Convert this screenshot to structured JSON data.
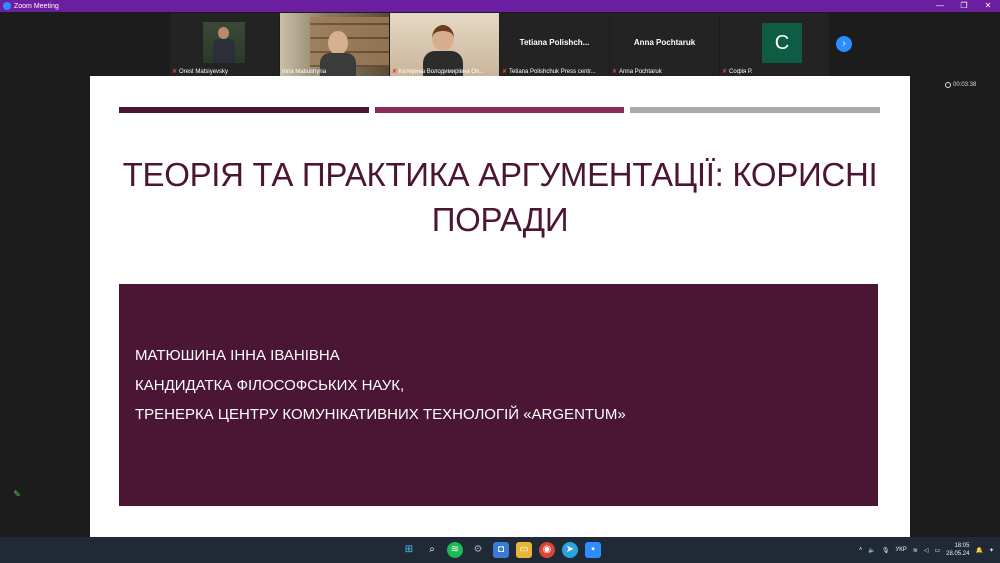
{
  "window": {
    "title": "Zoom Meeting",
    "minimize": "—",
    "maximize": "❐",
    "close": "✕"
  },
  "participants": [
    {
      "name": "Orest Matsiyevsky",
      "muted": true
    },
    {
      "name": "Inna Matiushyna",
      "muted": false
    },
    {
      "name": "Катерина Володимирівна Оп...",
      "muted": true
    },
    {
      "name": "Tetiana Polishchuk Press centr...",
      "label": "Tetiana  Polishch...",
      "muted": true
    },
    {
      "name": "Anna Pochtaruk",
      "label": "Anna Pochtaruk",
      "muted": true
    },
    {
      "name": "Софія Р.",
      "initial": "C",
      "muted": true
    }
  ],
  "next_arrow": "›",
  "timer": "00:03:38",
  "slide": {
    "title": "ТЕОРІЯ ТА ПРАКТИКА АРГУМЕНТАЦІЇ: КОРИСНІ ПОРАДИ",
    "line1": "МАТЮШИНА ІННА ІВАНІВНА",
    "line2": "КАНДИДАТКА  ФІЛОСОФСЬКИХ  НАУК,",
    "line3": "ТРЕНЕРКА  ЦЕНТРУ КОМУНІКАТИВНИХ ТЕХНОЛОГІЙ «ARGENTUM»"
  },
  "taskbar": {
    "language": "УКР",
    "time": "18:05",
    "date": "28.05.24"
  },
  "colors": {
    "accent": "#4b1633",
    "accent2": "#8a2a5a",
    "zoom_bar": "#6b1fa0"
  }
}
